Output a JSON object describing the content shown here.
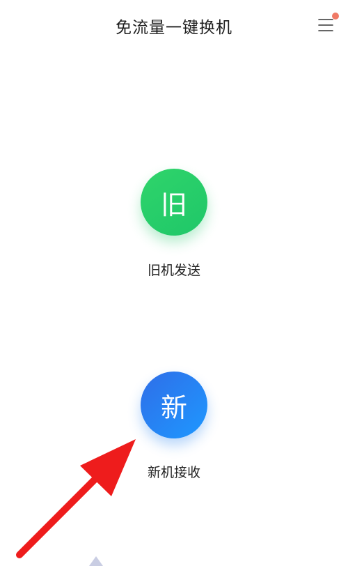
{
  "header": {
    "title": "免流量一键换机",
    "menu_icon": "menu-icon",
    "notification_dot_color": "#f07a66"
  },
  "actions": {
    "old_phone": {
      "icon_text": "旧",
      "label": "旧机发送",
      "color": "#22cc66"
    },
    "new_phone": {
      "icon_text": "新",
      "label": "新机接收",
      "color": "#2a84f5"
    }
  },
  "annotation": {
    "icon": "red-arrow-icon",
    "color": "#ee1c1c"
  }
}
